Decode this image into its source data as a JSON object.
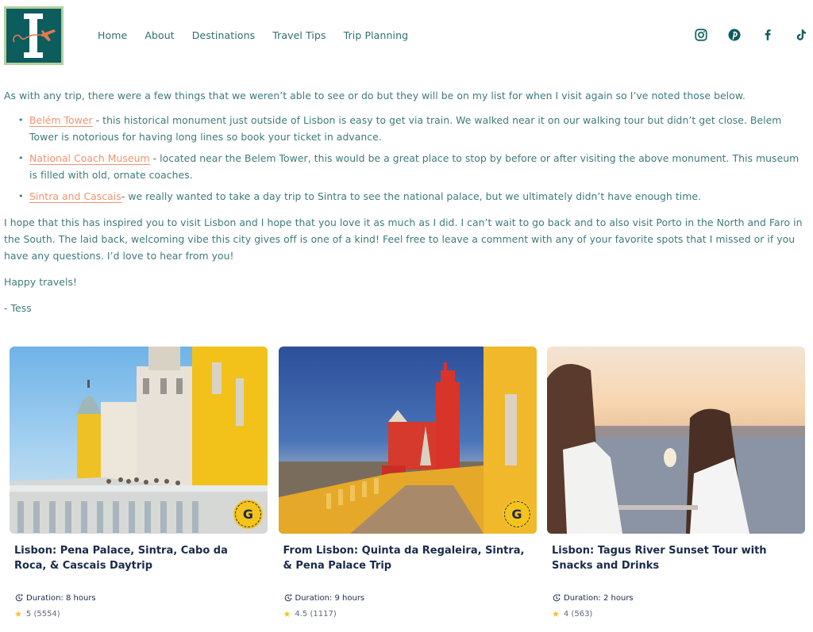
{
  "header": {
    "logo_alt": "Travel blog logo",
    "nav": [
      {
        "label": "Home"
      },
      {
        "label": "About"
      },
      {
        "label": "Destinations"
      },
      {
        "label": "Travel Tips"
      },
      {
        "label": "Trip Planning"
      }
    ],
    "social": [
      {
        "icon": "instagram-icon"
      },
      {
        "icon": "pinterest-icon"
      },
      {
        "icon": "facebook-icon"
      },
      {
        "icon": "tiktok-icon"
      }
    ]
  },
  "colors": {
    "brand_teal": "#0d5c5e",
    "text": "#3e7a7a",
    "link": "#f0936f",
    "card_title": "#1a2b49",
    "star": "#f6c21c"
  },
  "article": {
    "intro": "As with any trip, there were a few things that we weren’t able to see or do but they will be on my list for when I visit again so I’ve noted those below.",
    "items": [
      {
        "link": "Belém Tower",
        "text": " - this historical monument just outside of Lisbon is easy to get via train. We walked near it on our walking tour but didn’t get close. Belem Tower is notorious for having long lines so book your ticket in advance."
      },
      {
        "link": "National Coach Museum",
        "text": " - located near the Belem Tower, this would be a great place to stop by before or after visiting the above monument. This museum is filled with old, ornate coaches."
      },
      {
        "link": "Sintra and Cascais",
        "text": "- we really wanted to take a day trip to Sintra to see the national palace, but we ultimately didn’t have enough time."
      }
    ],
    "closing": "I hope that this has inspired you to visit Lisbon and I hope that you love it as much as I did. I can’t wait to go back and to also visit Porto in the North and Faro in the South. The laid back, welcoming vibe this city gives off is one of a kind! Feel free to leave a comment with any of your favorite spots that I missed or if you have any questions. I’d love to hear from you!",
    "signoff": "Happy travels!",
    "signature": "- Tess"
  },
  "tours": [
    {
      "title": "Lisbon: Pena Palace, Sintra, Cabo da Roca, & Cascais Daytrip",
      "duration": "Duration: 8 hours",
      "rating": "5",
      "reviews": "(5554)",
      "badge": "G",
      "image": "Pena Palace yellow facade"
    },
    {
      "title": "From Lisbon: Quinta da Regaleira, Sintra, & Pena Palace Trip",
      "duration": "Duration: 9 hours",
      "rating": "4.5",
      "reviews": "(1117)",
      "badge": "G",
      "image": "Pena Palace red tower"
    },
    {
      "title": "Lisbon: Tagus River Sunset Tour with Snacks and Drinks",
      "duration": "Duration: 2 hours",
      "rating": "4",
      "reviews": "(563)",
      "image": "Two women at sunset on river"
    }
  ]
}
